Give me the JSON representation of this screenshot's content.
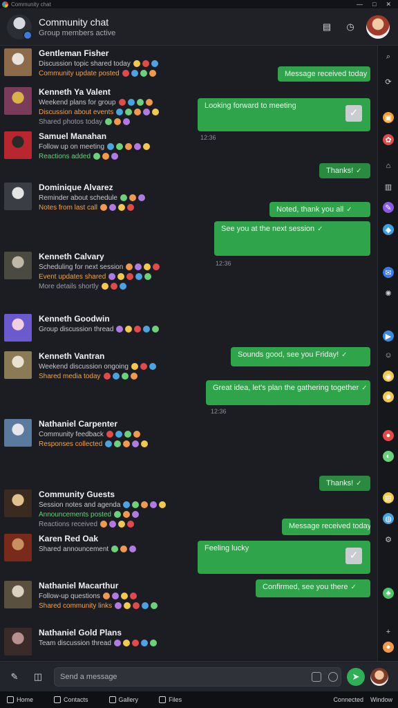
{
  "window": {
    "title": "Community chat",
    "controls": [
      "—",
      "□",
      "✕"
    ]
  },
  "header": {
    "title": "Community chat",
    "subtitle": "Group members active",
    "actions": [
      {
        "icon": "calendar-icon",
        "glyph": "▤"
      },
      {
        "icon": "clock-icon",
        "glyph": "◷"
      }
    ]
  },
  "chat": {
    "contacts": [
      {
        "name": "Gentleman Fisher",
        "lines": [
          "Discussion topic shared today",
          "Community update posted"
        ],
        "color_a": "#8c6a4a",
        "color_b": "#e6e2dc"
      },
      {
        "name": "Kenneth Ya Valent",
        "lines": [
          "Weekend plans for group",
          "Discussion about events",
          "Shared photos today"
        ],
        "color_a": "#7a3c5a",
        "color_b": "#d9b24a"
      },
      {
        "name": "Samuel Manahan",
        "lines": [
          "Follow up on meeting",
          "Reactions added"
        ],
        "color_a": "#b8262f",
        "color_b": "#2a2a2a"
      },
      {
        "name": "Dominique Alvarez",
        "lines": [
          "Reminder about schedule",
          "Notes from last call"
        ],
        "color_a": "#3a3d44",
        "color_b": "#e4e4e4"
      },
      {
        "name": "Kenneth Calvary",
        "lines": [
          "Scheduling for next session",
          "Event updates shared",
          "More details shortly"
        ],
        "color_a": "#4a4a40",
        "color_b": "#bfb8a8"
      },
      {
        "name": "Kenneth Goodwin",
        "lines": [
          "Group discussion thread"
        ],
        "color_a": "#6a5acd",
        "color_b": "#f0d0e0"
      },
      {
        "name": "Kenneth Vantran",
        "lines": [
          "Weekend discussion ongoing",
          "Shared media today"
        ],
        "color_a": "#8a7a55",
        "color_b": "#e8e2d0"
      },
      {
        "name": "Nathaniel Carpenter",
        "lines": [
          "Community feedback",
          "Responses collected"
        ],
        "color_a": "#5a7aa0",
        "color_b": "#e6e6ea"
      },
      {
        "name": "Community Guests",
        "lines": [
          "Session notes and agenda",
          "Announcements posted",
          "Reactions received"
        ],
        "color_a": "#3a2a20",
        "color_b": "#e0c090"
      },
      {
        "name": "Karen Red Oak",
        "lines": [
          "Shared announcement"
        ],
        "color_a": "#7a2a1a",
        "color_b": "#c89060"
      },
      {
        "name": "Nathaniel Macarthur",
        "lines": [
          "Follow-up questions",
          "Shared community links"
        ],
        "color_a": "#5a5040",
        "color_b": "#dcd2c0"
      },
      {
        "name": "Nathaniel Gold Plans",
        "lines": [
          "Team discussion thread"
        ],
        "color_a": "#3a2a2a",
        "color_b": "#b89090"
      }
    ],
    "bubbles": [
      {
        "text": "Message received today",
        "time": ""
      },
      {
        "text": "Looking forward to meeting",
        "time": "12:36"
      },
      {
        "text": "Thanks!",
        "time": ""
      },
      {
        "text": "Noted, thank you all",
        "time": ""
      },
      {
        "text": "See you at the next session",
        "time": "12:36"
      },
      {
        "text": "Sounds good, see you Friday!",
        "time": ""
      },
      {
        "text": "Great idea, let's plan the gathering together",
        "time": "12:36"
      },
      {
        "text": "Thanks!",
        "time": ""
      },
      {
        "text": "Message received today",
        "time": ""
      },
      {
        "text": "Feeling lucky",
        "time": ""
      },
      {
        "text": "Confirmed, see you there",
        "time": ""
      }
    ]
  },
  "rail": [
    "search-icon",
    "bell-icon",
    "apps-icon",
    "settings-icon",
    "home-icon",
    "grid-icon",
    "chat-icon",
    "shield-icon",
    "mail-icon",
    "globe-icon",
    "video-icon",
    "avatar-icon",
    "star-icon",
    "smile-icon",
    "red-app-icon",
    "game-icon",
    "folder-icon",
    "web-icon",
    "gear-icon",
    "leaf-icon",
    "plus-icon",
    "orange-app-icon"
  ],
  "composer": {
    "placeholder": "Send a message"
  },
  "taskbar": {
    "items": [
      "Home",
      "Contacts",
      "Gallery",
      "Files"
    ],
    "right": [
      "Connected",
      "Window"
    ]
  },
  "colors": {
    "bubble": "#2fa44a",
    "background": "#1b1d22",
    "accent": "#3d7be0"
  }
}
